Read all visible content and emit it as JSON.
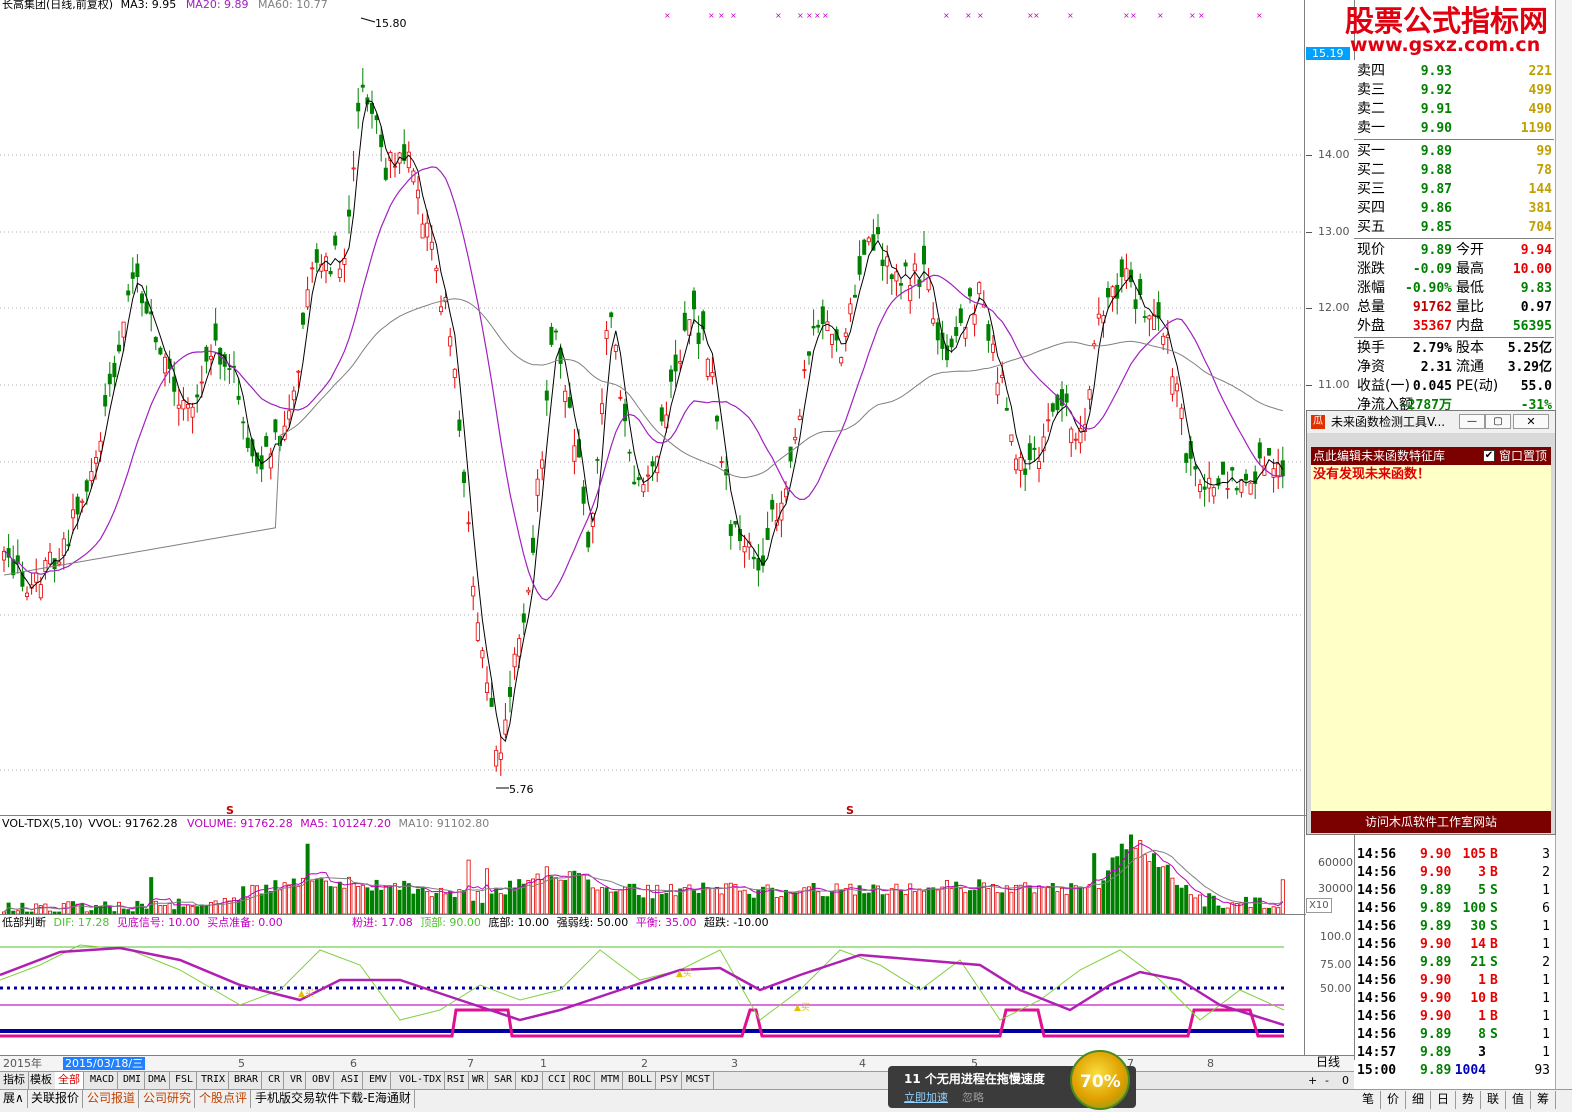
{
  "main_legend": {
    "name": "长高集团(日线,前复权)",
    "ma3": "MA3: 9.95",
    "ma20": "MA20: 9.89",
    "ma60": "MA60: 10.77"
  },
  "price_axis": [
    "15.19",
    "14.00",
    "13.00",
    "12.00",
    "11.00",
    "15.80",
    "5.76"
  ],
  "vol_legend": {
    "name": "VOL-TDX(5,10)",
    "vvol": "VVOL: 91762.28",
    "volume": "VOLUME: 91762.28",
    "ma5": "MA5: 101247.20",
    "ma10": "MA10: 91102.80"
  },
  "vol_axis": [
    "60000",
    "30000",
    "X10"
  ],
  "ind_legend": {
    "name": "低部判断",
    "dif": "DIF: 17.28",
    "see": "见底信号: 10.00",
    "buy": "买点准备: 0.00",
    "fen": "粉进: 17.08",
    "top": "顶部: 90.00",
    "bottom": "底部: 10.00",
    "strong": "强弱线: 50.00",
    "balance": "平衡: 35.00",
    "over": "超跌: -10.00"
  },
  "ind_axis": [
    "100.0",
    "75.00",
    "50.00"
  ],
  "date_axis": {
    "year": "2015年",
    "selected": "2015/03/18/三",
    "months": [
      "5",
      "6",
      "7",
      "1",
      "2",
      "3",
      "4",
      "5",
      "7",
      "8"
    ],
    "period": "日线"
  },
  "watermark": {
    "cn": "股票公式指标网",
    "url": "www.gsxz.com.cn"
  },
  "quote": {
    "sell": [
      {
        "label": "卖四",
        "price": "9.93",
        "vol": "221"
      },
      {
        "label": "卖三",
        "price": "9.92",
        "vol": "499"
      },
      {
        "label": "卖二",
        "price": "9.91",
        "vol": "490"
      },
      {
        "label": "卖一",
        "price": "9.90",
        "vol": "1190"
      }
    ],
    "buy": [
      {
        "label": "买一",
        "price": "9.89",
        "vol": "99"
      },
      {
        "label": "买二",
        "price": "9.88",
        "vol": "78"
      },
      {
        "label": "买三",
        "price": "9.87",
        "vol": "144"
      },
      {
        "label": "买四",
        "price": "9.86",
        "vol": "381"
      },
      {
        "label": "买五",
        "price": "9.85",
        "vol": "704"
      }
    ],
    "stats": [
      {
        "l1": "现价",
        "v1": "9.89",
        "l2": "今开",
        "v2": "9.94"
      },
      {
        "l1": "涨跌",
        "v1": "-0.09",
        "l2": "最高",
        "v2": "10.00"
      },
      {
        "l1": "涨幅",
        "v1": "-0.90%",
        "l2": "最低",
        "v2": "9.83"
      },
      {
        "l1": "总量",
        "v1": "91762",
        "l2": "量比",
        "v2": "0.97"
      },
      {
        "l1": "外盘",
        "v1": "35367",
        "l2": "内盘",
        "v2": "56395"
      },
      {
        "l1": "换手",
        "v1": "2.79%",
        "l2": "股本",
        "v2": "5.25亿"
      },
      {
        "l1": "净资",
        "v1": "2.31",
        "l2": "流通",
        "v2": "3.29亿"
      },
      {
        "l1": "收益(一)",
        "v1": "0.045",
        "l2": "PE(动)",
        "v2": "55.0"
      },
      {
        "l1": "净流入额",
        "v1": "-2787万",
        "l2": "",
        "v2": "-31%"
      }
    ]
  },
  "ticks": [
    {
      "time": "14:56",
      "price": "9.90",
      "vol": "105",
      "side": "B",
      "n": "3"
    },
    {
      "time": "14:56",
      "price": "9.90",
      "vol": "3",
      "side": "B",
      "n": "2"
    },
    {
      "time": "14:56",
      "price": "9.89",
      "vol": "5",
      "side": "S",
      "n": "1"
    },
    {
      "time": "14:56",
      "price": "9.89",
      "vol": "100",
      "side": "S",
      "n": "6"
    },
    {
      "time": "14:56",
      "price": "9.89",
      "vol": "30",
      "side": "S",
      "n": "1"
    },
    {
      "time": "14:56",
      "price": "9.90",
      "vol": "14",
      "side": "B",
      "n": "1"
    },
    {
      "time": "14:56",
      "price": "9.89",
      "vol": "21",
      "side": "S",
      "n": "2"
    },
    {
      "time": "14:56",
      "price": "9.90",
      "vol": "1",
      "side": "B",
      "n": "1"
    },
    {
      "time": "14:56",
      "price": "9.90",
      "vol": "10",
      "side": "B",
      "n": "1"
    },
    {
      "time": "14:56",
      "price": "9.90",
      "vol": "1",
      "side": "B",
      "n": "1"
    },
    {
      "time": "14:56",
      "price": "9.89",
      "vol": "8",
      "side": "S",
      "n": "1"
    },
    {
      "time": "14:57",
      "price": "9.89",
      "vol": "3",
      "side": "",
      "n": "1"
    },
    {
      "time": "15:00",
      "price": "9.89",
      "vol": "1004",
      "side": "",
      "n": "93"
    }
  ],
  "dialog": {
    "title": "未来函数检测工具V...",
    "bar": "点此编辑未来函数特征库",
    "checkbox": "窗口置顶",
    "message": "没有发现未来函数！",
    "footer": "访问木瓜软件工作室网站"
  },
  "tabs": [
    "指标",
    "模板",
    "全部",
    "MACD",
    "DMI",
    "DMA",
    "FSL",
    "TRIX",
    "BRAR",
    "CR",
    "VR",
    "OBV",
    "ASI",
    "EMV",
    "VOL-TDX",
    "RSI",
    "WR",
    "SAR",
    "KDJ",
    "CCI",
    "ROC",
    "MTM",
    "BOLL",
    "PSY",
    "MCST"
  ],
  "tabs2": [
    "展∧",
    "关联报价",
    "公司报道",
    "公司研究",
    "个股点评",
    "手机版交易软件下载-E海通财"
  ],
  "zoom": [
    "+",
    "-",
    "0"
  ],
  "right_tabs": [
    "笔",
    "价",
    "细",
    "日",
    "势",
    "联",
    "值",
    "筹"
  ],
  "toast": {
    "title": "11 个无用进程在拖慢速度",
    "speed": "立即加速",
    "ignore": "忽略",
    "pct": "70%"
  },
  "colors": {
    "up": "#e60000",
    "down": "#008000",
    "ma20": "#a020c0",
    "ma60": "#707070",
    "navy": "#0000a0",
    "magenta": "#e01090"
  }
}
